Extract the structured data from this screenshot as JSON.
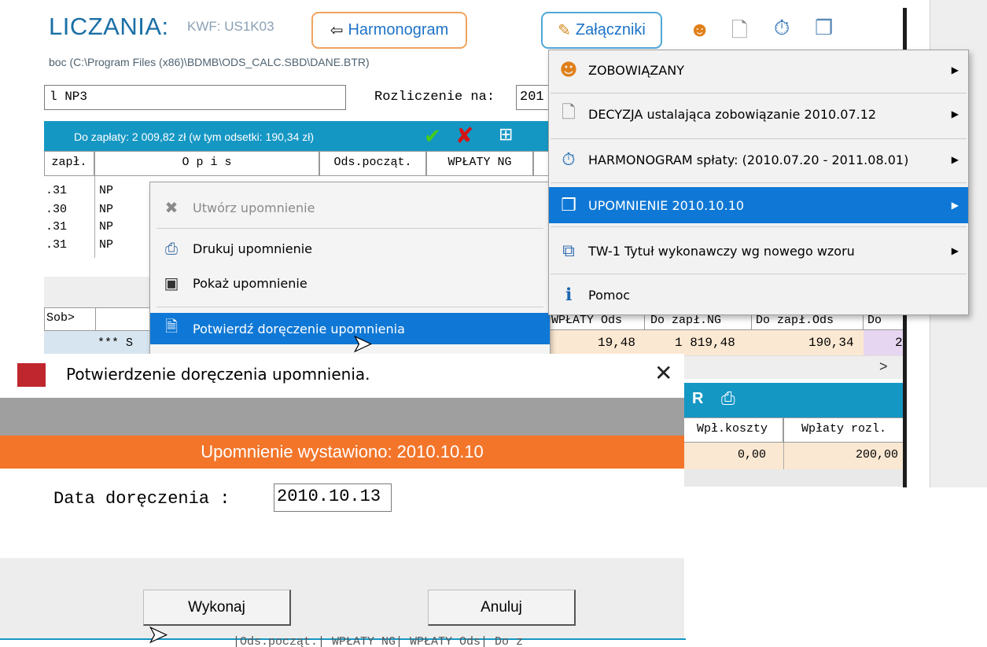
{
  "app": {
    "title": "LICZANIA:",
    "kwf": "KWF: US1K03",
    "harmonogram_label": "Harmonogram",
    "zalaczniki_label": "Załączniki",
    "path": "boc (C:\\Program Files (x86)\\BDMB\\ODS_CALC.SBD\\DANE.BTR)",
    "name_field": "l NP3",
    "rozliczenie_label": "Rozliczenie na:",
    "rozliczenie_value": "201",
    "summary": "Do zapłaty: 2 009,82 zł   (w tym odsetki: 190,34 zł)"
  },
  "upper_grid": {
    "headers": [
      "zapł.",
      "O p i s",
      "Ods.począt.",
      "WPŁATY NG"
    ],
    "rows": [
      {
        "date": ".31",
        "desc": "NP"
      },
      {
        "date": ".30",
        "desc": "NP"
      },
      {
        "date": ".31",
        "desc": "NP"
      },
      {
        "date": ".31",
        "desc": "NP"
      }
    ]
  },
  "lower_grid": {
    "head_left": "Sob>",
    "stars": "*** S"
  },
  "right_grid": {
    "header": "WPŁATY Ods | Do zapł.NG | Do zapł.Ods | Do",
    "headers": [
      "WPŁATY Ods",
      "Do zapł.NG",
      "Do zapł.Ods",
      "Do"
    ],
    "values": [
      "19,48",
      "1 819,48",
      "190,34",
      "2"
    ],
    "scroll_arrow": ">"
  },
  "lower_right_grid": {
    "r_label": "R",
    "headers": [
      "Wpł.koszty",
      "Wpłaty rozl."
    ],
    "values": [
      "0,00",
      "200,00"
    ]
  },
  "context_menu": {
    "items": [
      {
        "label": "Utwórz upomnienie",
        "icon": "pin-icon",
        "disabled": true
      },
      {
        "label": "Drukuj upomnienie",
        "icon": "printer-icon"
      },
      {
        "label": "Pokaż upomnienie",
        "icon": "window-icon"
      },
      {
        "label": "Potwierdź doręczenie upomnienia",
        "icon": "document-check-icon",
        "selected": true
      }
    ]
  },
  "zal_menu": {
    "items": [
      {
        "label": "ZOBOWIĄZANY",
        "icon": "person-icon"
      },
      {
        "label": "DECYZJA ustalająca zobowiązanie  2010.07.12",
        "icon": "document-icon"
      },
      {
        "label": "HARMONOGRAM spłaty: (2010.07.20 - 2011.08.01)",
        "icon": "stopwatch-icon"
      },
      {
        "label": "UPOMNIENIE  2010.10.10",
        "icon": "boxes-icon",
        "selected": true
      },
      {
        "label": "TW-1  Tytuł wykonawczy wg nowego wzoru",
        "icon": "copy-docs-icon"
      },
      {
        "label": "Pomoc",
        "icon": "info-icon"
      }
    ]
  },
  "dialog": {
    "title": "Potwierdzenie doręczenia upomnienia.",
    "close": "✕",
    "banner": "Upomnienie wystawiono: 2010.10.10",
    "date_label": "Data doręczenia   :",
    "date_value": "2010.10.13",
    "ok_label": "Wykonaj",
    "cancel_label": "Anuluj"
  },
  "bottom_strip": "|Ods.począt.| WPŁATY NG| WPŁATY Ods| Do z",
  "colors": {
    "teal": "#1597c4",
    "menu_highlight": "#0f78d6",
    "orange": "#f2752a",
    "row_peach": "#fbe8d2"
  }
}
